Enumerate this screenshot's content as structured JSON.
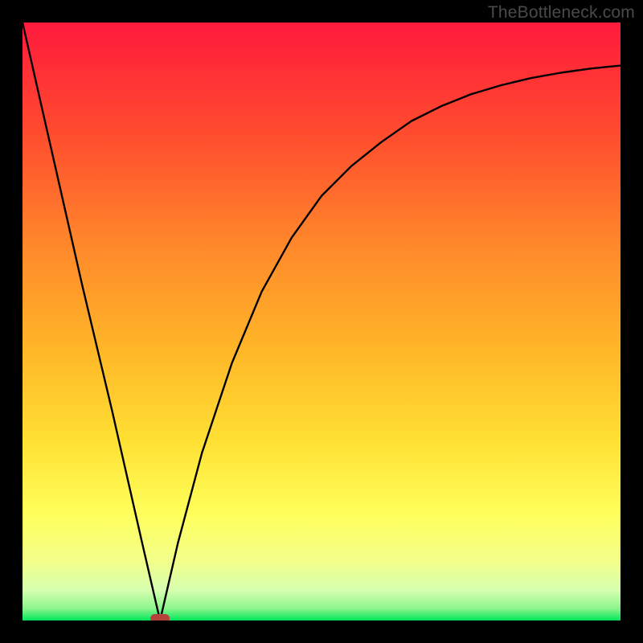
{
  "watermark": "TheBottleneck.com",
  "chart_data": {
    "type": "line",
    "title": "",
    "xlabel": "",
    "ylabel": "",
    "xlim": [
      0,
      100
    ],
    "ylim": [
      0,
      100
    ],
    "background_gradient": {
      "top": "#ff1a3c",
      "mid_upper": "#ff7a2a",
      "mid": "#ffd233",
      "mid_lower": "#ffff66",
      "lower": "#f7ffb0",
      "bottom": "#00e65a"
    },
    "marker": {
      "x": 23,
      "y": 0,
      "color": "#b6423c",
      "shape": "pill"
    },
    "series": [
      {
        "name": "bottleneck-curve",
        "x": [
          0,
          5,
          10,
          15,
          20,
          23,
          26,
          30,
          35,
          40,
          45,
          50,
          55,
          60,
          65,
          70,
          75,
          80,
          85,
          90,
          95,
          100
        ],
        "values": [
          100,
          78,
          56,
          35,
          13,
          0,
          13,
          28,
          43,
          55,
          64,
          71,
          76,
          80,
          83.5,
          86,
          88,
          89.5,
          90.7,
          91.6,
          92.3,
          92.8
        ]
      }
    ]
  }
}
